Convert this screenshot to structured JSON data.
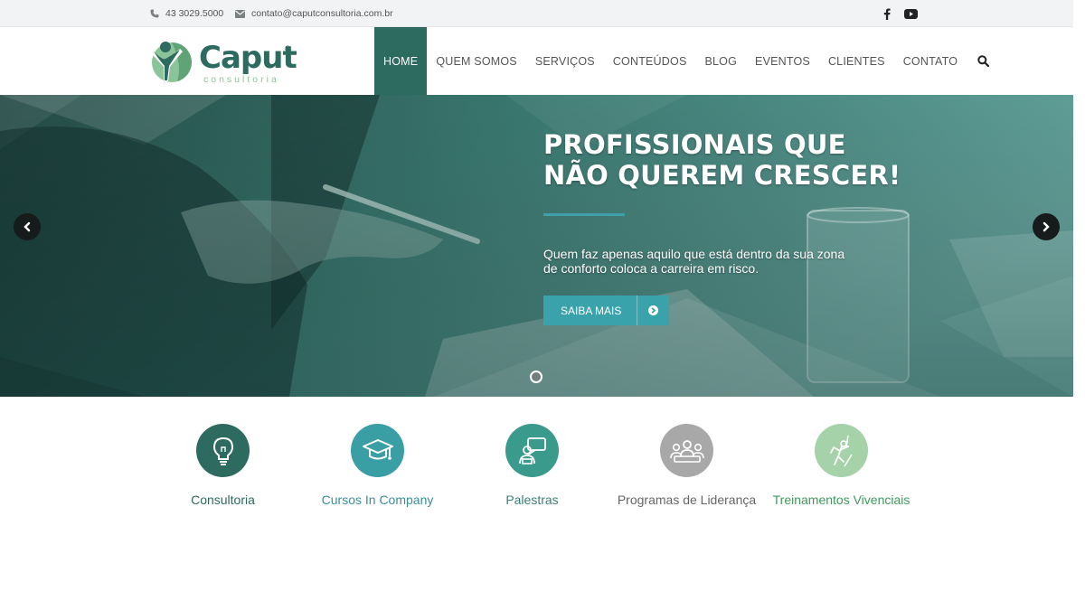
{
  "topbar": {
    "phone": "43 3029.5000",
    "email": "contato@caputconsultoria.com.br",
    "social": [
      {
        "name": "facebook-icon"
      },
      {
        "name": "youtube-icon"
      }
    ]
  },
  "logo": {
    "name": "Caput",
    "reg": "®",
    "tagline": "consultoria"
  },
  "nav": {
    "items": [
      {
        "label": "HOME",
        "active": true
      },
      {
        "label": "QUEM SOMOS"
      },
      {
        "label": "SERVIÇOS"
      },
      {
        "label": "CONTEÚDOS"
      },
      {
        "label": "BLOG"
      },
      {
        "label": "EVENTOS"
      },
      {
        "label": "CLIENTES"
      },
      {
        "label": "CONTATO"
      }
    ],
    "search_icon": "search-icon"
  },
  "hero": {
    "title_line1": "PROFISSIONAIS QUE",
    "title_line2": "NÃO QUEREM CRESCER!",
    "subtitle_line1": "Quem faz apenas aquilo que está dentro da sua zona",
    "subtitle_line2": "de conforto coloca a carreira em risco.",
    "button_label": "SAIBA MAIS",
    "button_icon": "arrow-circle-right-icon",
    "slide_count": 1,
    "active_slide": 1
  },
  "services": [
    {
      "label": "Consultoria",
      "icon": "lightbulb-icon",
      "color": "#2d6a5f"
    },
    {
      "label": "Cursos In Company",
      "icon": "graduation-cap-icon",
      "color": "#3a9ea5"
    },
    {
      "label": "Palestras",
      "icon": "speaker-icon",
      "color": "#3a9a8c"
    },
    {
      "label": "Programas de Liderança",
      "icon": "team-icon",
      "color": "#a8a8a8"
    },
    {
      "label": "Treinamentos Vivenciais",
      "icon": "climber-icon",
      "color": "#a5d2a8"
    }
  ],
  "colors": {
    "brand": "#2d6a5f",
    "accent": "#3aa2ab",
    "topbar_bg": "#f2f3f4"
  }
}
